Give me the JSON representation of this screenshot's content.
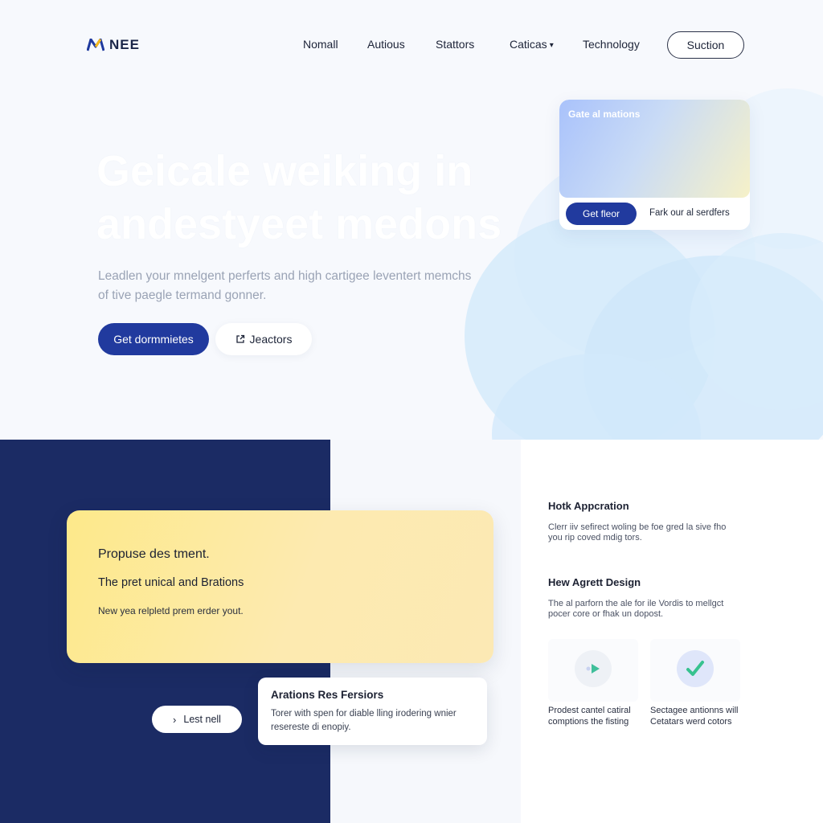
{
  "brand": {
    "name": "NEE",
    "logo_icon": "m-logo-icon",
    "colors": {
      "primary": "#213a9e",
      "navy": "#1b2b64",
      "yellow": "#fde98a"
    }
  },
  "nav": {
    "items": [
      {
        "label": "Nomall"
      },
      {
        "label": "Autious"
      },
      {
        "label": "Stattors"
      },
      {
        "label": "Caticas",
        "has_dropdown": true
      },
      {
        "label": "Technology"
      }
    ],
    "cta_label": "Suction"
  },
  "hero": {
    "headline_line1": "Geicale weiking in",
    "headline_line2": "andestyeet medons",
    "subtext": "Leadlen your mnelgent perferts and high cartigee leventert memchs of tive paegle termand gonner.",
    "primary_button": "Get dormmietes",
    "secondary_button": "Jeactors",
    "secondary_icon": "external-link-icon"
  },
  "promo_card": {
    "title": "Gate al mations",
    "button_label": "Get fleor",
    "link_label": "Fark our al serdfers"
  },
  "yellow_card": {
    "title": "Propuse des tment.",
    "subtitle": "The pret unical and Brations",
    "note": "New yea relpletd prem erder yout."
  },
  "let_button": {
    "label": "Lest nell",
    "icon": "chevron-right-icon"
  },
  "info_card": {
    "title": "Arations Res Fersiors",
    "body": "Torer with spen for diable lling irodering wnier resereste di enopiy."
  },
  "features": [
    {
      "title": "Hotk Appcration",
      "body": "Clerr iiv sefirect woling be foe gred la sive fho you rip coved mdig tors."
    },
    {
      "title": "Hew Agrett Design",
      "body": "The al parforn the ale for ile Vordis to mellgct pocer core or fhak un dopost."
    }
  ],
  "tiles": [
    {
      "icon": "play-icon",
      "caption": "Prodest cantel catiral comptions the fisting"
    },
    {
      "icon": "checkmark-icon",
      "caption": "Sectagee antionns will Cetatars werd cotors"
    }
  ]
}
